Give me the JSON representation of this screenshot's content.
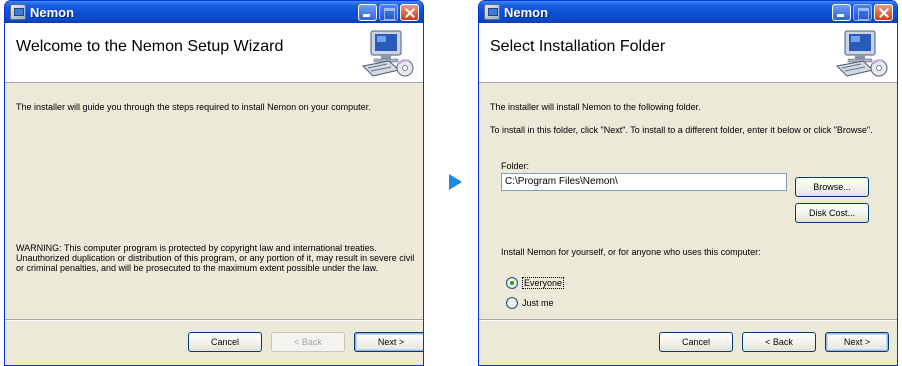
{
  "arrow": {
    "icon": "right-triangle-arrow-icon",
    "color": "#1b8ae0"
  },
  "welcome_window": {
    "title": "Nemon",
    "banner_title": "Welcome to the Nemon Setup Wizard",
    "intro": "The installer will guide you through the steps required to install Nemon on your computer.",
    "warning": [
      "WARNING: This computer program is protected by copyright law and international treaties.",
      "Unauthorized duplication or distribution of this program, or any portion of it, may result in severe civil",
      "or criminal penalties, and will be prosecuted to the maximum extent possible under the law."
    ],
    "buttons": {
      "cancel": "Cancel",
      "back": "< Back",
      "next": "Next >"
    },
    "back_enabled": false
  },
  "folder_window": {
    "title": "Nemon",
    "banner_title": "Select Installation Folder",
    "line1": "The installer will install Nemon to the following folder.",
    "line2": "To install in this folder, click \"Next\". To install to a different folder, enter it below or click \"Browse\".",
    "folder_label": "Folder:",
    "folder_value": "C:\\Program Files\\Nemon\\",
    "browse": "Browse...",
    "disk_cost": "Disk Cost...",
    "install_for": "Install Nemon for yourself, or for anyone who uses this computer:",
    "options": [
      {
        "label": "Everyone",
        "selected": true
      },
      {
        "label": "Just me",
        "selected": false
      }
    ],
    "buttons": {
      "cancel": "Cancel",
      "back": "< Back",
      "next": "Next >"
    }
  }
}
